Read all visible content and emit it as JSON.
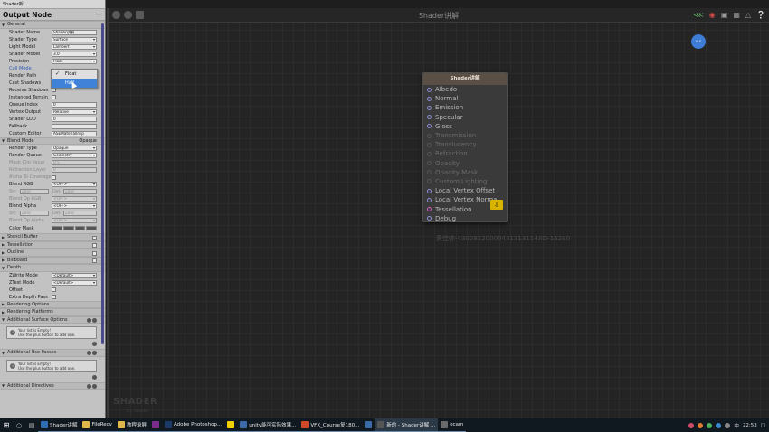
{
  "window": {
    "tab_title": "Shader新..."
  },
  "panel": {
    "title": "Output Node",
    "sections": {
      "general": "General",
      "blend_mode": "Blend Mode",
      "blend_mode_value": "Opaque",
      "stencil_buffer": "Stencil Buffer",
      "tessellation": "Tessellation",
      "outline": "Outline",
      "billboard": "Billboard",
      "depth": "Depth",
      "rendering_options": "Rendering Options",
      "rendering_platforms": "Rendering Platforms",
      "additional_surface_options": "Additional Surface Options",
      "additional_use_passes": "Additional Use Passes",
      "additional_directives": "Additional Directives"
    },
    "general_props": [
      {
        "label": "Shader Name",
        "value": "Shader讲解"
      },
      {
        "label": "Shader Type",
        "value": "Surface"
      },
      {
        "label": "Light Model",
        "value": "Lambert"
      },
      {
        "label": "Shader Model",
        "value": "3.0"
      },
      {
        "label": "Precision",
        "value": "Float"
      },
      {
        "label": "Cull Mode",
        "value": ""
      },
      {
        "label": "Render Path",
        "value": ""
      },
      {
        "label": "Cast Shadows",
        "value": ""
      },
      {
        "label": "Receive Shadows",
        "value": ""
      },
      {
        "label": "Instanced Terrain",
        "value": ""
      },
      {
        "label": "Queue Index",
        "value": "0"
      },
      {
        "label": "Vertex Output",
        "value": "Relative"
      },
      {
        "label": "Shader LOD",
        "value": "0"
      },
      {
        "label": "Fallback",
        "value": ""
      },
      {
        "label": "Custom Editor",
        "value": "ASEMaterialInsp"
      }
    ],
    "blend_props": [
      {
        "label": "Render Type",
        "value": "Opaque"
      },
      {
        "label": "Render Queue",
        "value": "Geometry"
      },
      {
        "label": "Mask Clip Value",
        "value": "0.5"
      },
      {
        "label": "Refraction Layer",
        "value": "0"
      },
      {
        "label": "Alpha To Coverage",
        "value": ""
      },
      {
        "label": "Blend RGB",
        "value": "<OFF>"
      },
      {
        "label": "Src",
        "value": "Zero",
        "label2": "Dst",
        "value2": "Zero"
      },
      {
        "label": "Blend Op RGB",
        "value": "<OFF>"
      },
      {
        "label": "Blend Alpha",
        "value": "<OFF>"
      },
      {
        "label": "Src",
        "value": "Zero",
        "label2": "Dst",
        "value2": "Zero"
      },
      {
        "label": "Blend Op Alpha",
        "value": "<OFF>"
      },
      {
        "label": "Color Mask",
        "value": ""
      }
    ],
    "depth_props": [
      {
        "label": "ZWrite Mode",
        "value": "<Default>"
      },
      {
        "label": "ZTest Mode",
        "value": "<Default>"
      },
      {
        "label": "Offset",
        "value": ""
      },
      {
        "label": "Extra Depth Pass",
        "value": ""
      }
    ],
    "empty_list": {
      "line1": "Your list is Empty!",
      "line2": "Use the plus button to add one."
    },
    "precision_dropdown": {
      "options": [
        "Float",
        "Half"
      ],
      "selected": "Float",
      "hover": "Half"
    }
  },
  "canvas": {
    "title": "Shader讲解",
    "top_indicator": "ULE",
    "node": {
      "title": "Shader讲解",
      "ports": [
        {
          "label": "Albedo",
          "enabled": true
        },
        {
          "label": "Normal",
          "enabled": true
        },
        {
          "label": "Emission",
          "enabled": true
        },
        {
          "label": "Specular",
          "enabled": true
        },
        {
          "label": "Gloss",
          "enabled": true
        },
        {
          "label": "Transmission",
          "enabled": false
        },
        {
          "label": "Translucency",
          "enabled": false
        },
        {
          "label": "Refraction",
          "enabled": false
        },
        {
          "label": "Opacity",
          "enabled": false
        },
        {
          "label": "Opacity Mask",
          "enabled": false
        },
        {
          "label": "Custom Lighting",
          "enabled": false
        },
        {
          "label": "Local Vertex Offset",
          "enabled": true
        },
        {
          "label": "Local Vertex Normal",
          "enabled": true
        },
        {
          "label": "Tessellation",
          "enabled": true,
          "pink": true
        },
        {
          "label": "Debug",
          "enabled": true
        }
      ]
    },
    "watermark": "黄佳帅-4302812000043131311-UID-15290",
    "logo": "SHADER",
    "logo_sub": "by Shader"
  },
  "taskbar": {
    "items": [
      {
        "label": "Shader讲解",
        "color": "#2f6db3"
      },
      {
        "label": "FileRecv",
        "color": "#e0b84a"
      },
      {
        "label": "教程录屏",
        "color": "#e0b84a"
      },
      {
        "label": "",
        "color": "#7b2d8e"
      },
      {
        "label": "Adobe Photoshop...",
        "color": "#1c3a6a"
      },
      {
        "label": "",
        "color": "#f0d000"
      },
      {
        "label": "unity能可实际效果...",
        "color": "#3a6aa8"
      },
      {
        "label": "VFX_Course复180...",
        "color": "#d04a2a"
      },
      {
        "label": "",
        "color": "#3a6aa8"
      },
      {
        "label": "新的 - Shader讲解 ...",
        "color": "#555555"
      },
      {
        "label": "ocam",
        "color": "#6a6a6a"
      }
    ],
    "clock": "22:53"
  }
}
